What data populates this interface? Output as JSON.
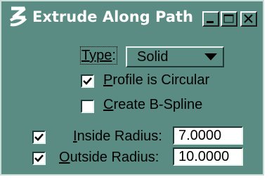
{
  "window": {
    "title": "Extrude Along Path",
    "controls": [
      "minimize-icon",
      "maximize-icon",
      "close-icon"
    ],
    "bg_color": "#5a8c83"
  },
  "type": {
    "label_prefix": "Type",
    "label_suffix": ":",
    "selected": "Solid"
  },
  "profile_circular": {
    "label_u": "P",
    "label_rest": "rofile is Circular",
    "checked": true
  },
  "create_bspline": {
    "label_u": "C",
    "label_rest": "reate B-Spline",
    "checked": false
  },
  "inside_radius": {
    "label_u": "I",
    "label_rest": "nside Radius:",
    "value": "7.0000",
    "checked": true
  },
  "outside_radius": {
    "label_u": "O",
    "label_rest": "utside Radius:",
    "value": "10.0000",
    "checked": true
  }
}
